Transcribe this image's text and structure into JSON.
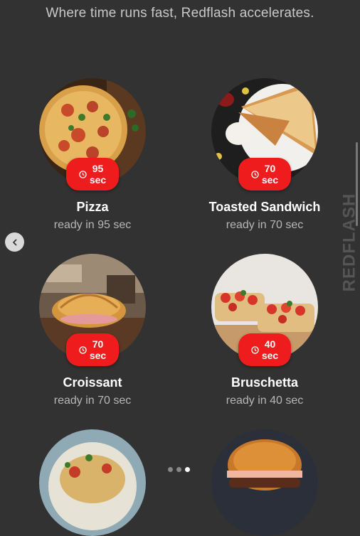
{
  "tagline": "Where time runs fast, Redflash accelerates.",
  "watermark": "REDFLASH",
  "items": [
    {
      "name": "Pizza",
      "time": "95",
      "unit": "sec",
      "ready": "ready in 95 sec"
    },
    {
      "name": "Toasted Sandwich",
      "time": "70",
      "unit": "sec",
      "ready": "ready in 70 sec"
    },
    {
      "name": "Croissant",
      "time": "70",
      "unit": "sec",
      "ready": "ready in 70 sec"
    },
    {
      "name": "Bruschetta",
      "time": "40",
      "unit": "sec",
      "ready": "ready in 40 sec"
    }
  ],
  "carousel": {
    "page_count": 3,
    "active_page": 3
  },
  "colors": {
    "background": "#323232",
    "badge": "#ee1c1c"
  }
}
